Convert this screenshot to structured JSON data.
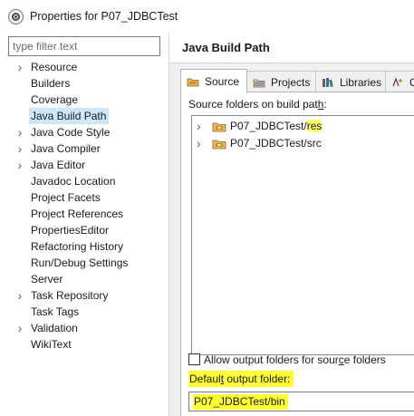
{
  "window": {
    "title": "Properties for P07_JDBCTest"
  },
  "filter": {
    "placeholder": "type filter text"
  },
  "nav": {
    "items": [
      {
        "label": "Resource",
        "expandable": true,
        "selected": false
      },
      {
        "label": "Builders",
        "expandable": false,
        "selected": false
      },
      {
        "label": "Coverage",
        "expandable": false,
        "selected": false
      },
      {
        "label": "Java Build Path",
        "expandable": false,
        "selected": true
      },
      {
        "label": "Java Code Style",
        "expandable": true,
        "selected": false
      },
      {
        "label": "Java Compiler",
        "expandable": true,
        "selected": false
      },
      {
        "label": "Java Editor",
        "expandable": true,
        "selected": false
      },
      {
        "label": "Javadoc Location",
        "expandable": false,
        "selected": false
      },
      {
        "label": "Project Facets",
        "expandable": false,
        "selected": false
      },
      {
        "label": "Project References",
        "expandable": false,
        "selected": false
      },
      {
        "label": "PropertiesEditor",
        "expandable": false,
        "selected": false
      },
      {
        "label": "Refactoring History",
        "expandable": false,
        "selected": false
      },
      {
        "label": "Run/Debug Settings",
        "expandable": false,
        "selected": false
      },
      {
        "label": "Server",
        "expandable": false,
        "selected": false
      },
      {
        "label": "Task Repository",
        "expandable": true,
        "selected": false
      },
      {
        "label": "Task Tags",
        "expandable": false,
        "selected": false
      },
      {
        "label": "Validation",
        "expandable": true,
        "selected": false
      },
      {
        "label": "WikiText",
        "expandable": false,
        "selected": false
      }
    ]
  },
  "page": {
    "title": "Java Build Path"
  },
  "tabs": {
    "source": "Source",
    "projects": "Projects",
    "libraries": "Libraries",
    "order_partial": "O"
  },
  "source_tab": {
    "label_before": "Source folders on build pat",
    "label_mnemonic": "h",
    "label_after": ":",
    "folders": [
      {
        "prefix": "P07_JDBCTest/",
        "name": "res",
        "highlighted": true
      },
      {
        "prefix": "P07_JDBCTest/",
        "name": "src",
        "highlighted": false
      }
    ],
    "allow_output_before": "Allow output folders for sour",
    "allow_output_mnemonic": "c",
    "allow_output_after": "e folders",
    "allow_output_checked": false,
    "output_label_before": "Defaul",
    "output_label_mnemonic": "t",
    "output_label_after": " output folder:",
    "output_value": "P07_JDBCTest/bin"
  },
  "colors": {
    "highlight": "#ffff33",
    "selection": "#cce8ff"
  },
  "icons": {
    "tree_expander": "chevron-right-icon",
    "folder": "package-folder-icon"
  }
}
